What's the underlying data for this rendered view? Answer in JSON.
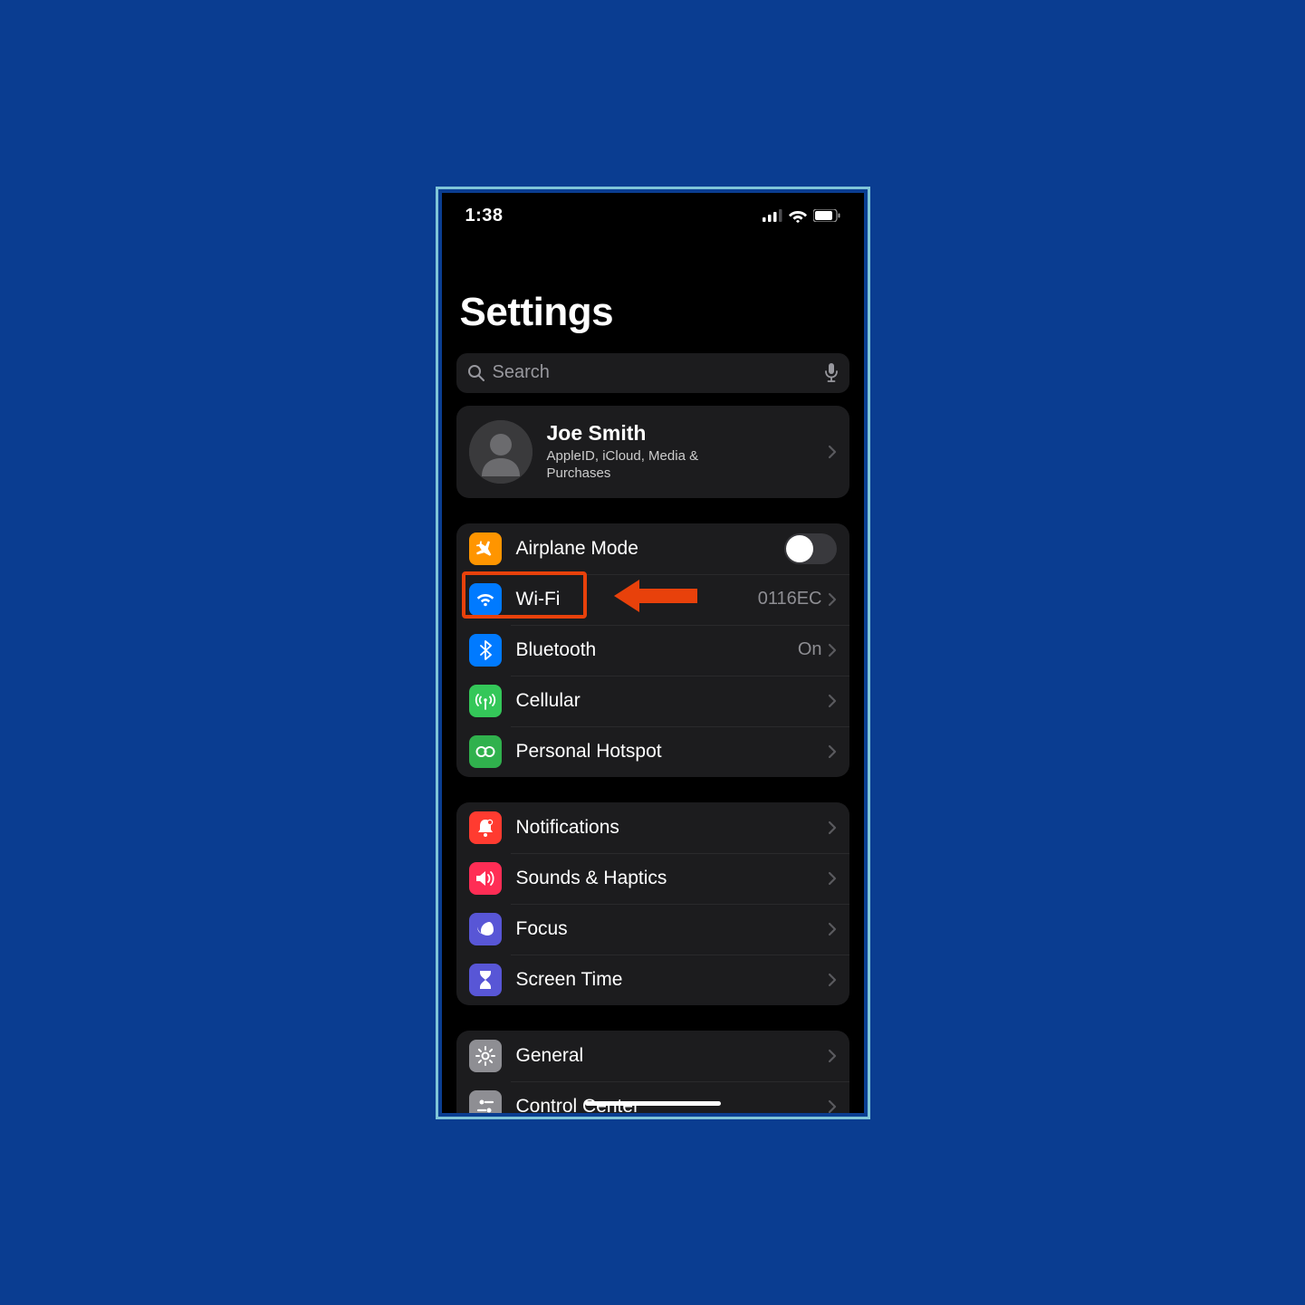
{
  "status": {
    "time": "1:38"
  },
  "title": "Settings",
  "search": {
    "placeholder": "Search"
  },
  "profile": {
    "name": "Joe Smith",
    "subtitle": "AppleID, iCloud, Media & Purchases"
  },
  "connectivity": {
    "airplane": {
      "label": "Airplane Mode"
    },
    "wifi": {
      "label": "Wi-Fi",
      "value": "0116EC"
    },
    "bluetooth": {
      "label": "Bluetooth",
      "value": "On"
    },
    "cellular": {
      "label": "Cellular"
    },
    "hotspot": {
      "label": "Personal Hotspot"
    }
  },
  "alerts": {
    "notifications": {
      "label": "Notifications"
    },
    "sounds": {
      "label": "Sounds & Haptics"
    },
    "focus": {
      "label": "Focus"
    },
    "screentime": {
      "label": "Screen Time"
    }
  },
  "general_group": {
    "general": {
      "label": "General"
    },
    "controlcenter": {
      "label": "Control Center"
    }
  }
}
